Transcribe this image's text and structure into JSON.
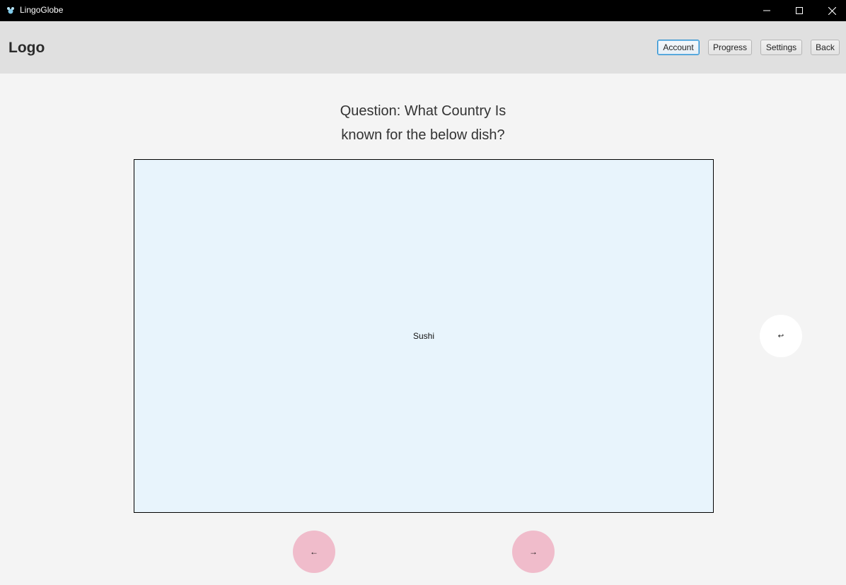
{
  "window": {
    "title": "LingoGlobe",
    "controls": {
      "minimize_icon": "minimize-icon",
      "maximize_icon": "maximize-icon",
      "close_icon": "close-icon"
    }
  },
  "header": {
    "logo": "Logo",
    "nav": {
      "account": "Account",
      "progress": "Progress",
      "settings": "Settings",
      "back": "Back"
    }
  },
  "question": {
    "line1": "Question: What Country Is",
    "line2": "known for the below dish?"
  },
  "card": {
    "text": "Sushi"
  },
  "controls": {
    "flip": "↩",
    "previous": "←",
    "next": "→"
  },
  "colors": {
    "titlebar": "#000000",
    "header": "#e0e0e0",
    "background": "#f4f4f4",
    "card": "#e8f4fc",
    "nav_circle": "#f0bccb",
    "focus_accent": "#2a8fd0"
  }
}
